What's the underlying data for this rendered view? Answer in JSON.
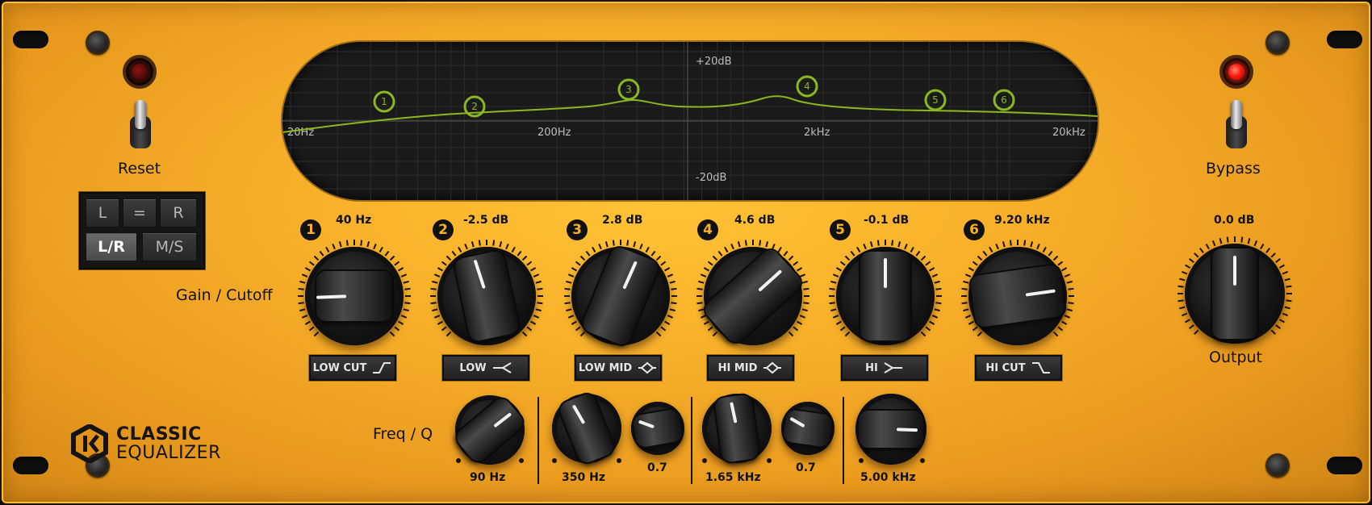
{
  "plugin": {
    "brand": {
      "line1": "CLASSIC",
      "line2": "EQUALIZER"
    },
    "reset_label": "Reset",
    "bypass_label": "Bypass",
    "gain_cutoff_label": "Gain / Cutoff",
    "freq_q_label": "Freq / Q",
    "output": {
      "value": "0.0 dB",
      "label": "Output"
    },
    "reset_led": "off",
    "bypass_led": "on",
    "channel_modes": {
      "left": "L",
      "link": "=",
      "right": "R",
      "lr": "L/R",
      "ms": "M/S",
      "active": "L/R"
    },
    "display": {
      "db_top": "+20dB",
      "db_bottom": "-20dB",
      "freq_labels": [
        "20Hz",
        "200Hz",
        "2kHz",
        "20kHz"
      ],
      "markers": [
        "1",
        "2",
        "3",
        "4",
        "5",
        "6"
      ],
      "curve_color": "#8ab81e"
    },
    "bands": [
      {
        "num": "1",
        "value": "40 Hz",
        "type": "LOW CUT",
        "icon": "low-cut-icon"
      },
      {
        "num": "2",
        "value": "-2.5 dB",
        "type": "LOW",
        "icon": "low-shelf-icon"
      },
      {
        "num": "3",
        "value": "2.8 dB",
        "type": "LOW MID",
        "icon": "bell-icon"
      },
      {
        "num": "4",
        "value": "4.6 dB",
        "type": "HI MID",
        "icon": "bell-icon"
      },
      {
        "num": "5",
        "value": "-0.1 dB",
        "type": "HI",
        "icon": "high-shelf-icon"
      },
      {
        "num": "6",
        "value": "9.20 kHz",
        "type": "HI CUT",
        "icon": "high-cut-icon"
      }
    ],
    "freq_q": {
      "low": {
        "freq": "90 Hz"
      },
      "low_mid": {
        "freq": "350 Hz",
        "q": "0.7"
      },
      "hi_mid": {
        "freq": "1.65 kHz",
        "q": "0.7"
      },
      "hi": {
        "freq": "5.00 kHz"
      }
    },
    "accent_color": "#f7b02a"
  }
}
